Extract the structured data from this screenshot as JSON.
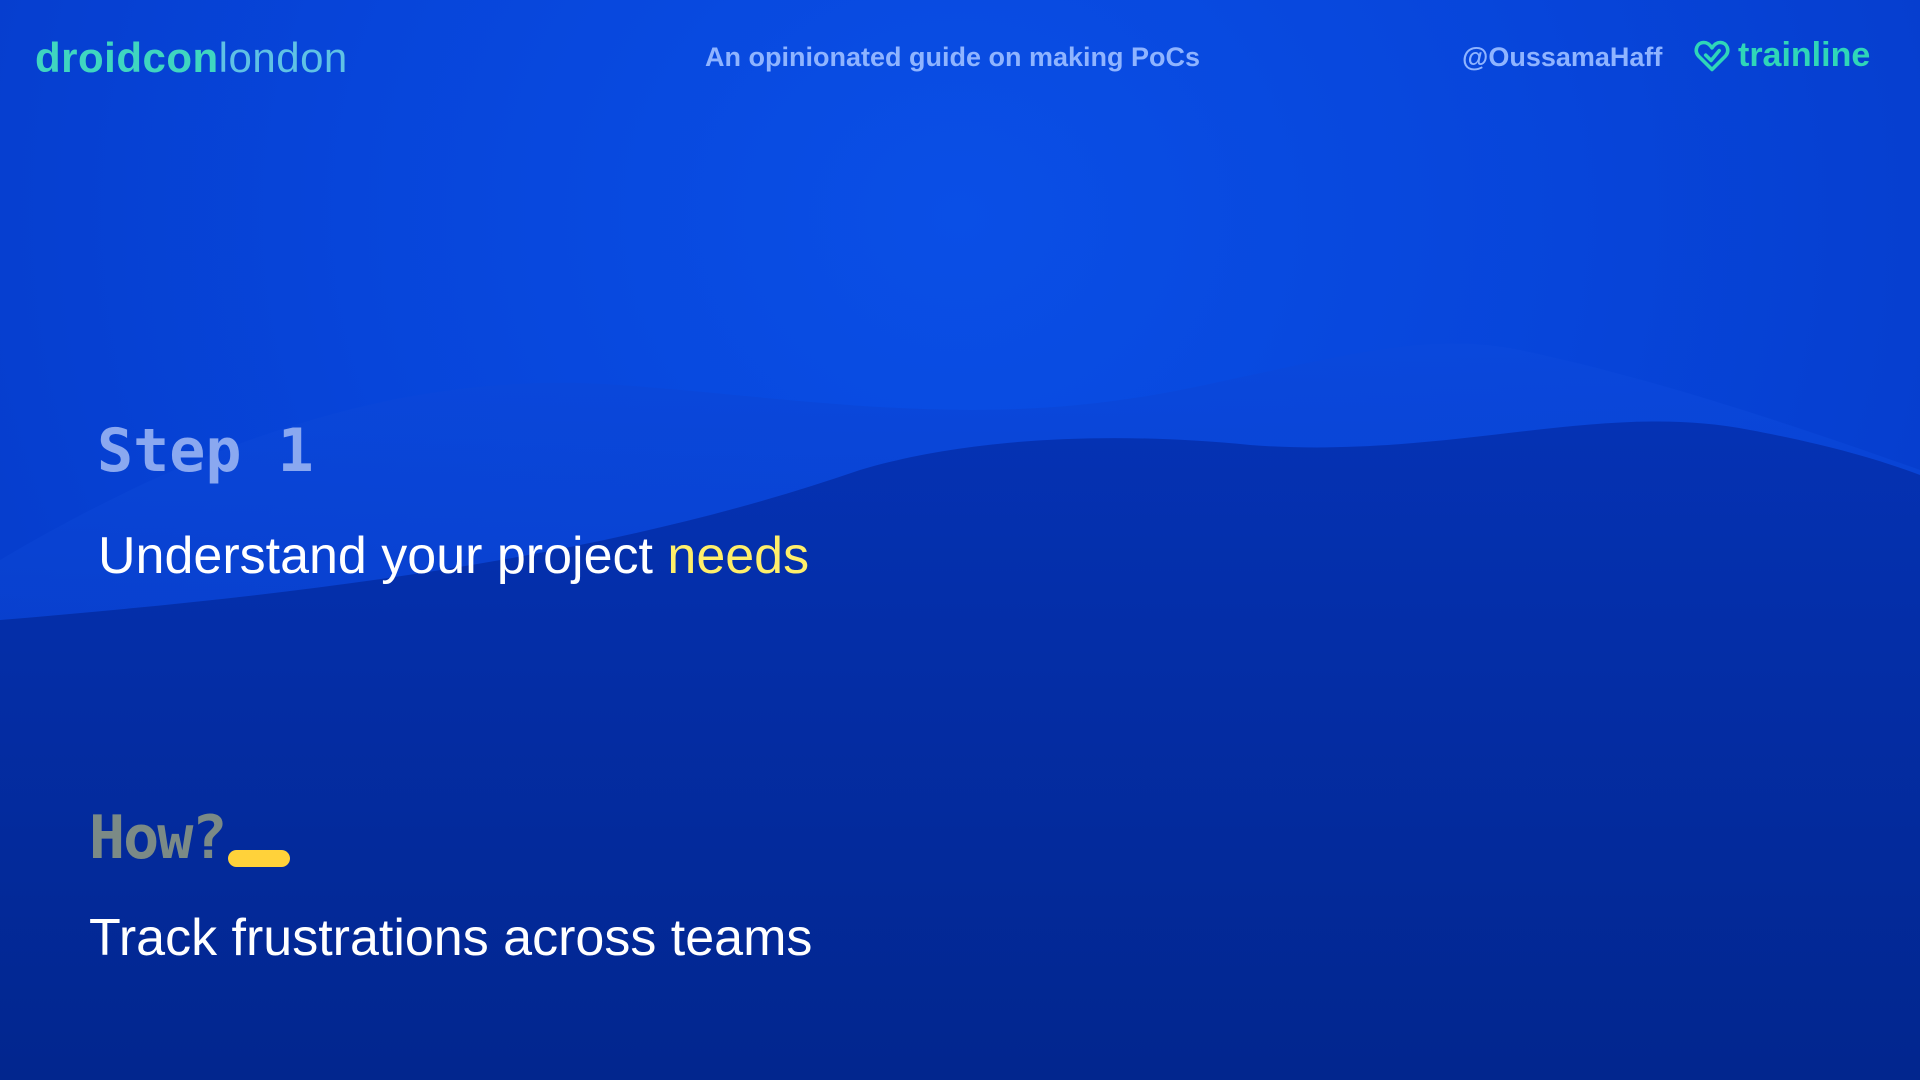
{
  "header": {
    "logo_brand": "droidcon",
    "logo_city": "london",
    "talk_title": "An opinionated guide on making PoCs",
    "handle": "@OussamaHaff",
    "sponsor_name": "trainline",
    "sponsor_icon": "heart-check-icon"
  },
  "main": {
    "step_label": "Step 1",
    "step_text_prefix": "Understand your project ",
    "step_text_highlight": "needs",
    "how_label": "How?",
    "how_text": "Track frustrations across teams"
  },
  "colors": {
    "background": "#0842d8",
    "accent_teal": "#3fd6c0",
    "highlight_yellow": "#ffef6a",
    "cursor_yellow": "#ffd23a"
  }
}
